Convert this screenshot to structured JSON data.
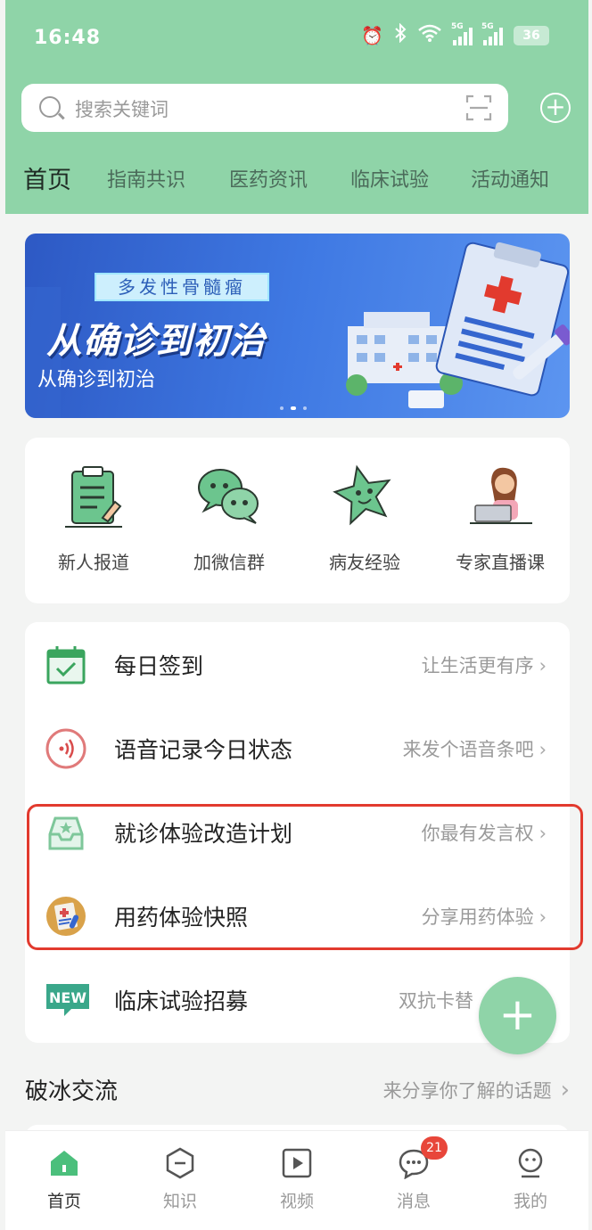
{
  "status_bar": {
    "time": "16:48",
    "battery": "36",
    "signal_tag": "5G"
  },
  "search": {
    "placeholder": "搜索关键词"
  },
  "tabs": [
    {
      "label": "首页",
      "active": true
    },
    {
      "label": "指南共识"
    },
    {
      "label": "医药资讯"
    },
    {
      "label": "临床试验"
    },
    {
      "label": "活动通知"
    }
  ],
  "banner": {
    "tag": "多发性骨髓瘤",
    "headline": "从确诊到初治",
    "subtitle": "从确诊到初治"
  },
  "quick_entries": [
    {
      "label": "新人报道",
      "icon": "clipboard-icon"
    },
    {
      "label": "加微信群",
      "icon": "chat-bubbles-icon"
    },
    {
      "label": "病友经验",
      "icon": "star-face-icon"
    },
    {
      "label": "专家直播课",
      "icon": "doctor-laptop-icon"
    }
  ],
  "list": [
    {
      "title": "每日签到",
      "sub": "让生活更有序",
      "icon": "calendar-check-icon"
    },
    {
      "title": "语音记录今日状态",
      "sub": "来发个语音条吧",
      "icon": "voice-icon"
    },
    {
      "title": "就诊体验改造计划",
      "sub": "你最有发言权",
      "icon": "inbox-star-icon"
    },
    {
      "title": "用药体验快照",
      "sub": "分享用药体验",
      "icon": "medicine-report-icon"
    },
    {
      "title": "临床试验招募",
      "sub": "双抗卡替",
      "icon": "new-badge-icon"
    }
  ],
  "section": {
    "title": "破冰交流",
    "more": "来分享你了解的话题"
  },
  "nav": [
    {
      "label": "首页",
      "icon": "home-icon",
      "active": true
    },
    {
      "label": "知识",
      "icon": "knowledge-icon"
    },
    {
      "label": "视频",
      "icon": "video-icon"
    },
    {
      "label": "消息",
      "icon": "message-icon",
      "badge": "21"
    },
    {
      "label": "我的",
      "icon": "profile-icon"
    }
  ],
  "colors": {
    "brand": "#8fd4a8",
    "highlight_border": "#e23a2e",
    "badge": "#e8463a"
  }
}
